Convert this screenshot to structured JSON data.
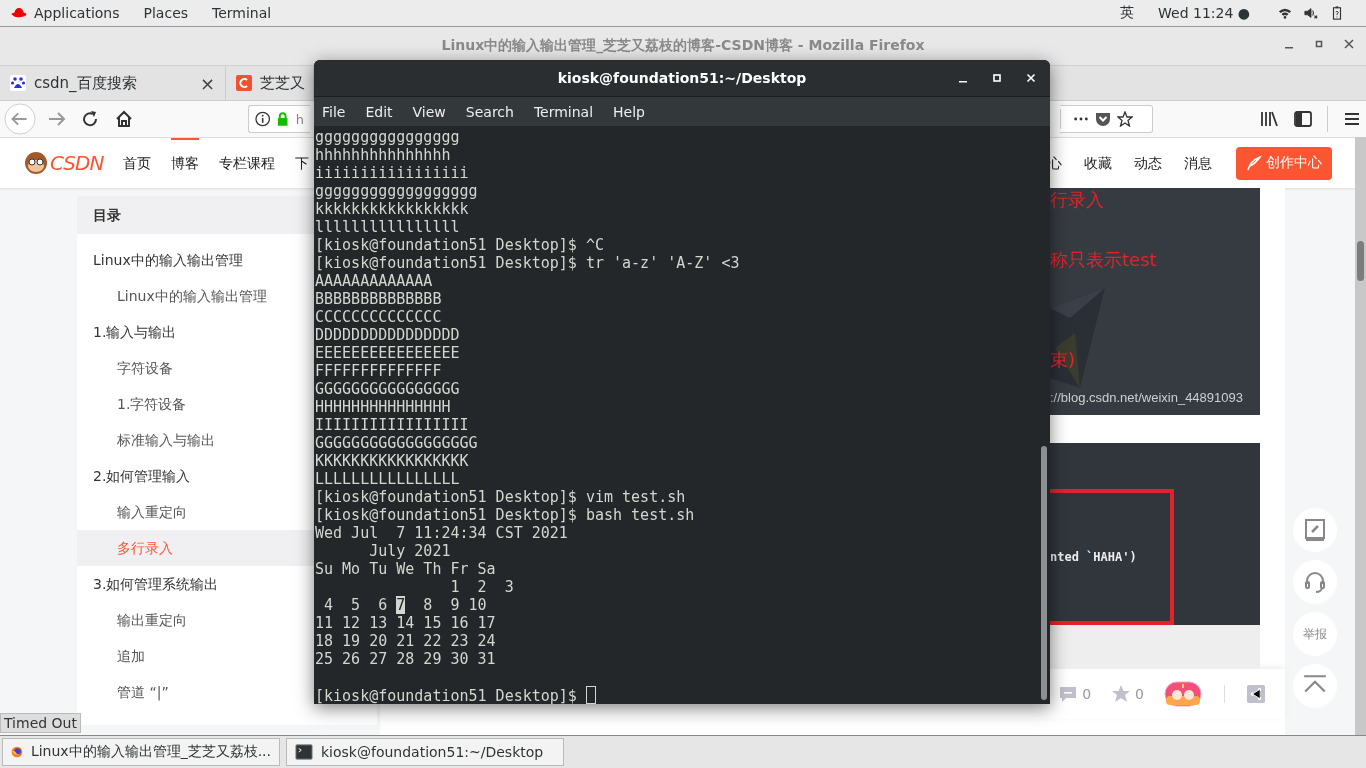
{
  "top_bar": {
    "menus": [
      "Applications",
      "Places",
      "Terminal"
    ],
    "input_method": "英",
    "clock": "Wed 11:24 ●"
  },
  "firefox": {
    "title": "Linux中的输入输出管理_芝芝又荔枝的博客-CSDN博客 - Mozilla Firefox",
    "tabs": [
      {
        "label": "csdn_百度搜索",
        "close": "×"
      },
      {
        "label": "芝芝又"
      }
    ],
    "url": "h",
    "page": {
      "logo": "CSDN",
      "nav_left": [
        {
          "label": "首页",
          "selected": false
        },
        {
          "label": "博客",
          "selected": true
        },
        {
          "label": "专栏课程",
          "selected": false
        },
        {
          "label": "下",
          "selected": false
        }
      ],
      "nav_right": [
        "心",
        "收藏",
        "动态",
        "消息"
      ],
      "create_button": "创作中心",
      "toc": {
        "title": "目录",
        "items": [
          {
            "label": "Linux中的输入输出管理",
            "selected": false,
            "children": [
              {
                "label": "Linux中的输入输出管理",
                "selected": false
              }
            ]
          },
          {
            "label": "1.输入与输出",
            "selected": false,
            "children": [
              {
                "label": "字符设备",
                "selected": false
              },
              {
                "label": "1.字符设备",
                "selected": false
              },
              {
                "label": "标准输入与输出",
                "selected": false
              }
            ]
          },
          {
            "label": "2.如何管理输入",
            "selected": false,
            "children": [
              {
                "label": "输入重定向",
                "selected": false
              },
              {
                "label": "多行录入",
                "selected": true
              }
            ]
          },
          {
            "label": "3.如何管理系统输出",
            "selected": false,
            "children": [
              {
                "label": "输出重定向",
                "selected": false
              },
              {
                "label": "追加",
                "selected": false
              },
              {
                "label": "管道 “|”",
                "selected": false
              }
            ]
          }
        ]
      },
      "image_1": {
        "red_lines": [
          "行录入",
          "称只表示test",
          "束)"
        ],
        "url": "://blog.csdn.net/weixin_44891093"
      },
      "image_2": {
        "code": "nted `HAHA')"
      },
      "float_buttons": [
        {
          "kind": "edit"
        },
        {
          "kind": "headset"
        },
        {
          "kind": "text",
          "label": "举报"
        },
        {
          "kind": "top"
        }
      ],
      "toolbar": [
        {
          "kind": "comment",
          "count": "0"
        },
        {
          "kind": "star",
          "count": "0"
        },
        {
          "kind": "reward"
        },
        {
          "kind": "share"
        }
      ]
    },
    "status": "Timed Out"
  },
  "terminal": {
    "title": "kiosk@foundation51:~/Desktop",
    "menus": [
      "File",
      "Edit",
      "View",
      "Search",
      "Terminal",
      "Help"
    ],
    "lines": [
      {
        "kind": "text",
        "text": "gggggggggggggggg"
      },
      {
        "kind": "text",
        "text": "hhhhhhhhhhhhhhh"
      },
      {
        "kind": "text",
        "text": "iiiiiiiiiiiiiiiii"
      },
      {
        "kind": "text",
        "text": "gggggggggggggggggg"
      },
      {
        "kind": "text",
        "text": "kkkkkkkkkkkkkkkkk"
      },
      {
        "kind": "text",
        "text": "llllllllllllllll"
      },
      {
        "kind": "text",
        "text": "[kiosk@foundation51 Desktop]$ ^C"
      },
      {
        "kind": "text",
        "text": "[kiosk@foundation51 Desktop]$ tr 'a-z' 'A-Z' <3"
      },
      {
        "kind": "text",
        "text": "AAAAAAAAAAAAA"
      },
      {
        "kind": "text",
        "text": "BBBBBBBBBBBBBB"
      },
      {
        "kind": "text",
        "text": "CCCCCCCCCCCCCC"
      },
      {
        "kind": "text",
        "text": "DDDDDDDDDDDDDDDD"
      },
      {
        "kind": "text",
        "text": "EEEEEEEEEEEEEEEE"
      },
      {
        "kind": "text",
        "text": "FFFFFFFFFFFFFF"
      },
      {
        "kind": "text",
        "text": "GGGGGGGGGGGGGGGG"
      },
      {
        "kind": "text",
        "text": "HHHHHHHHHHHHHHH"
      },
      {
        "kind": "text",
        "text": "IIIIIIIIIIIIIIIII"
      },
      {
        "kind": "text",
        "text": "GGGGGGGGGGGGGGGGGG"
      },
      {
        "kind": "text",
        "text": "KKKKKKKKKKKKKKKKK"
      },
      {
        "kind": "text",
        "text": "LLLLLLLLLLLLLLLL"
      },
      {
        "kind": "text",
        "text": "[kiosk@foundation51 Desktop]$ vim test.sh"
      },
      {
        "kind": "text",
        "text": "[kiosk@foundation51 Desktop]$ bash test.sh"
      },
      {
        "kind": "text",
        "text": "Wed Jul  7 11:24:34 CST 2021"
      },
      {
        "kind": "text",
        "text": "      July 2021"
      },
      {
        "kind": "text",
        "text": "Su Mo Tu We Th Fr Sa"
      },
      {
        "kind": "text",
        "text": "               1  2  3"
      },
      {
        "kind": "parts",
        "parts": [
          {
            "text": " 4  5  6 ",
            "selected": false
          },
          {
            "text": "7",
            "selected": true
          },
          {
            "text": "  8  9 10",
            "selected": false
          }
        ]
      },
      {
        "kind": "text",
        "text": "11 12 13 14 15 16 17"
      },
      {
        "kind": "text",
        "text": "18 19 20 21 22 23 24"
      },
      {
        "kind": "text",
        "text": "25 26 27 28 29 30 31"
      },
      {
        "kind": "blank"
      },
      {
        "kind": "prompt",
        "text": "[kiosk@foundation51 Desktop]$",
        "cursor": true
      }
    ]
  },
  "taskbar": [
    {
      "kind": "firefox",
      "label": "Linux中的输入输出管理_芝芝又荔枝..."
    },
    {
      "kind": "terminal",
      "label": "kiosk@foundation51:~/Desktop"
    }
  ]
}
